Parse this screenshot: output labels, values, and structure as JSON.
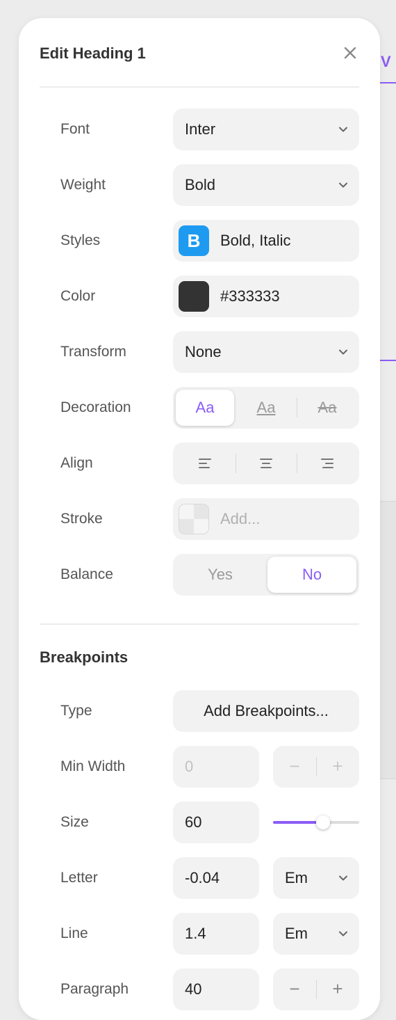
{
  "background": {
    "tab_label": "V"
  },
  "panel": {
    "title": "Edit Heading 1",
    "close_icon": "close-icon"
  },
  "typography": {
    "font": {
      "label": "Font",
      "value": "Inter"
    },
    "weight": {
      "label": "Weight",
      "value": "Bold"
    },
    "styles": {
      "label": "Styles",
      "icon_letter": "B",
      "value": "Bold, Italic",
      "icon_color": "#1e9bf0"
    },
    "color": {
      "label": "Color",
      "value": "#333333",
      "swatch": "#333333"
    },
    "transform": {
      "label": "Transform",
      "value": "None"
    },
    "decoration": {
      "label": "Decoration",
      "options": [
        {
          "text": "Aa",
          "style": "none",
          "active": true
        },
        {
          "text": "Aa",
          "style": "underline",
          "active": false
        },
        {
          "text": "Aa",
          "style": "line-through",
          "active": false
        }
      ]
    },
    "align": {
      "label": "Align",
      "options": [
        "align-left-icon",
        "align-center-icon",
        "align-right-icon"
      ]
    },
    "stroke": {
      "label": "Stroke",
      "placeholder": "Add..."
    },
    "balance": {
      "label": "Balance",
      "options": [
        "Yes",
        "No"
      ],
      "selected": "No"
    }
  },
  "breakpoints": {
    "title": "Breakpoints",
    "type": {
      "label": "Type",
      "button": "Add Breakpoints..."
    },
    "min_width": {
      "label": "Min Width",
      "value": "0",
      "minus": "−",
      "plus": "+"
    },
    "size": {
      "label": "Size",
      "value": "60",
      "slider_fraction": 0.58
    },
    "letter": {
      "label": "Letter",
      "value": "-0.04",
      "unit": "Em"
    },
    "line": {
      "label": "Line",
      "value": "1.4",
      "unit": "Em"
    },
    "paragraph": {
      "label": "Paragraph",
      "value": "40",
      "minus": "−",
      "plus": "+"
    }
  },
  "colors": {
    "accent": "#8b5cf6",
    "field_bg": "#f2f2f2",
    "text": "#333333"
  }
}
